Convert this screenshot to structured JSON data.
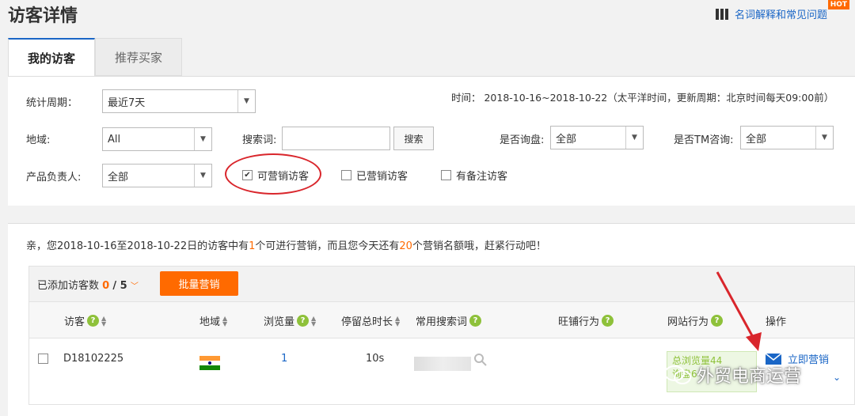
{
  "header": {
    "title": "访客详情",
    "help_link": "名词解释和常见问题",
    "hot_badge": "HOT"
  },
  "tabs": [
    {
      "label": "我的访客",
      "active": true
    },
    {
      "label": "推荐买家",
      "active": false
    }
  ],
  "filters": {
    "period_label": "统计周期：",
    "period_value": "最近7天",
    "time_info": "时间： 2018-10-16~2018-10-22（太平洋时间，更新周期：北京时间每天09:00前）",
    "region_label": "地域:",
    "region_value": "All",
    "keyword_label": "搜索词:",
    "keyword_value": "",
    "search_button": "搜索",
    "inquiry_label": "是否询盘:",
    "inquiry_value": "全部",
    "tm_label": "是否TM咨询:",
    "tm_value": "全部",
    "owner_label": "产品负责人:",
    "owner_value": "全部",
    "checkboxes": [
      {
        "label": "可营销访客",
        "checked": true
      },
      {
        "label": "已营销访客",
        "checked": false
      },
      {
        "label": "有备注访客",
        "checked": false
      }
    ]
  },
  "notice": {
    "p1": "亲，您2018-10-16至2018-10-22日的访客中有",
    "n1": "1",
    "p2": "个可进行营销，而且您今天还有",
    "n2": "20",
    "p3": "个营销名额哦，赶紧行动吧！"
  },
  "toolbar": {
    "added_label": "已添加访客数",
    "added_value": "0",
    "added_total": "/ 5",
    "bulk_button": "批量营销"
  },
  "table": {
    "headers": [
      "访客",
      "地域",
      "浏览量",
      "停留总时长",
      "常用搜索词",
      "旺铺行为",
      "网站行为",
      "操作"
    ],
    "rows": [
      {
        "visitor": "D18102225",
        "region_flag": "india-flag",
        "views": "1",
        "duration": "10s",
        "site_behavior": "总浏览量44",
        "site_behavior_2": "询盘6",
        "action": "立即营销"
      }
    ]
  },
  "watermark": "外贸电商运营",
  "colors": {
    "accent": "#ff6a00",
    "link": "#1a66c6",
    "annotation": "#d9262c",
    "green": "#8ec13a"
  }
}
